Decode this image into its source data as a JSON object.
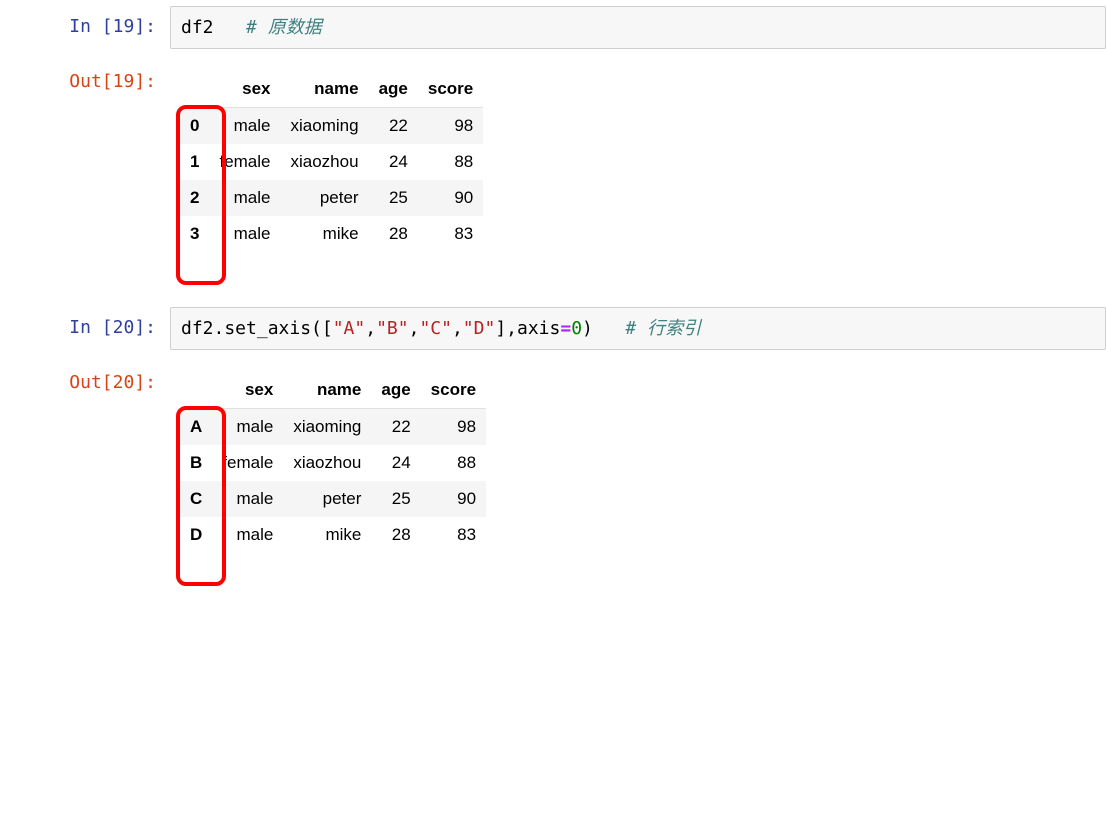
{
  "cells": [
    {
      "in_prompt": "In [19]:",
      "out_prompt": "Out[19]:",
      "code": {
        "expr": "df2",
        "comment": "# 原数据"
      },
      "table": {
        "columns": [
          "sex",
          "name",
          "age",
          "score"
        ],
        "index": [
          "0",
          "1",
          "2",
          "3"
        ],
        "rows": [
          [
            "male",
            "xiaoming",
            "22",
            "98"
          ],
          [
            "female",
            "xiaozhou",
            "24",
            "88"
          ],
          [
            "male",
            "peter",
            "25",
            "90"
          ],
          [
            "male",
            "mike",
            "28",
            "83"
          ]
        ]
      }
    },
    {
      "in_prompt": "In [20]:",
      "out_prompt": "Out[20]:",
      "code": {
        "prefix": "df2.set_axis([",
        "args": [
          "\"A\"",
          "\"B\"",
          "\"C\"",
          "\"D\""
        ],
        "sep": ",",
        "after_bracket": "],axis",
        "eq": "=",
        "axis_val": "0",
        "close": ")",
        "comment": "# 行索引"
      },
      "table": {
        "columns": [
          "sex",
          "name",
          "age",
          "score"
        ],
        "index": [
          "A",
          "B",
          "C",
          "D"
        ],
        "rows": [
          [
            "male",
            "xiaoming",
            "22",
            "98"
          ],
          [
            "female",
            "xiaozhou",
            "24",
            "88"
          ],
          [
            "male",
            "peter",
            "25",
            "90"
          ],
          [
            "male",
            "mike",
            "28",
            "83"
          ]
        ]
      }
    }
  ]
}
